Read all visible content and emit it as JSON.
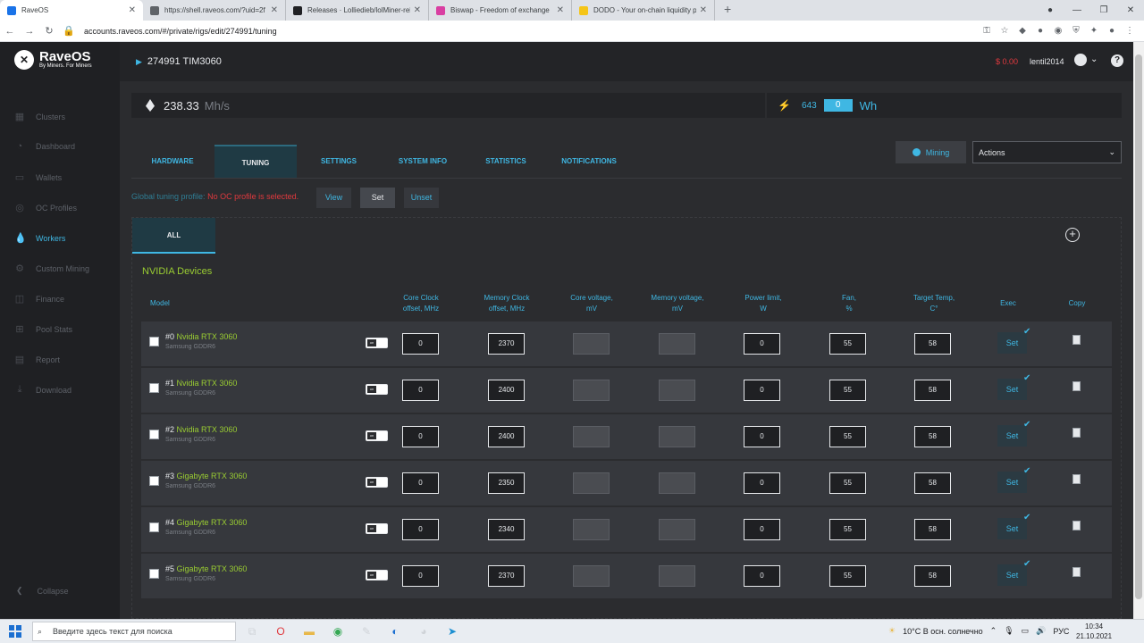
{
  "browser": {
    "tabs": [
      {
        "title": "RaveOS",
        "color": "#1a73e8",
        "active": true
      },
      {
        "title": "https://shell.raveos.com/?uid=2f",
        "color": "#5f6368",
        "active": false
      },
      {
        "title": "Releases · Lolliedieb/lolMiner-rel",
        "color": "#202124",
        "active": false
      },
      {
        "title": "Biswap - Freedom of exchange",
        "color": "#d93fa2",
        "active": false
      },
      {
        "title": "DODO - Your on-chain liquidity p",
        "color": "#f5c518",
        "active": false
      }
    ],
    "url": "accounts.raveos.com/#/private/rigs/edit/274991/tuning"
  },
  "app": {
    "logo_name": "RaveOS",
    "logo_sub": "By Miners. For Miners",
    "rig_title": "274991 TIM3060",
    "balance": "$ 0.00",
    "username": "lentil2014"
  },
  "sidebar": {
    "items": [
      {
        "label": "Clusters",
        "icon": "▦"
      },
      {
        "label": "Dashboard",
        "icon": "◔"
      },
      {
        "label": "Wallets",
        "icon": "▭"
      },
      {
        "label": "OC Profiles",
        "icon": "◎"
      },
      {
        "label": "Workers",
        "icon": "💧"
      },
      {
        "label": "Custom Mining",
        "icon": "⚙"
      },
      {
        "label": "Finance",
        "icon": "◫"
      },
      {
        "label": "Pool Stats",
        "icon": "⊞"
      },
      {
        "label": "Report",
        "icon": "▤"
      },
      {
        "label": "Download",
        "icon": "⤓"
      }
    ],
    "collapse": "Collapse"
  },
  "stats": {
    "hashrate": "238.33",
    "hash_unit": "Mh/s",
    "power_a": "643",
    "power_b": "0",
    "power_unit": "Wh"
  },
  "tabs": [
    "HARDWARE",
    "TUNING",
    "SETTINGS",
    "SYSTEM INFO",
    "STATISTICS",
    "NOTIFICATIONS"
  ],
  "mining_label": "Mining",
  "actions_label": "Actions",
  "global": {
    "label": "Global tuning profile:",
    "status": "No OC profile is selected.",
    "view": "View",
    "set": "Set",
    "unset": "Unset"
  },
  "panel": {
    "all_tab": "ALL",
    "section": "NVIDIA Devices"
  },
  "headers": {
    "model": "Model",
    "core_clock_1": "Core Clock",
    "core_clock_2": "offset, MHz",
    "mem_clock_1": "Memory Clock",
    "mem_clock_2": "offset, MHz",
    "core_v_1": "Core voltage,",
    "core_v_2": "mV",
    "mem_v_1": "Memory voltage,",
    "mem_v_2": "mV",
    "power_1": "Power limit,",
    "power_2": "W",
    "fan_1": "Fan,",
    "fan_2": "%",
    "temp_1": "Target Temp,",
    "temp_2": "C°",
    "exec": "Exec",
    "copy": "Copy"
  },
  "gpus": [
    {
      "idx": "#0",
      "name": "Nvidia RTX 3060",
      "mem": "Samsung GDDR6",
      "core": "0",
      "memclk": "2370",
      "power": "0",
      "fan": "55",
      "temp": "58"
    },
    {
      "idx": "#1",
      "name": "Nvidia RTX 3060",
      "mem": "Samsung GDDR6",
      "core": "0",
      "memclk": "2400",
      "power": "0",
      "fan": "55",
      "temp": "58"
    },
    {
      "idx": "#2",
      "name": "Nvidia RTX 3060",
      "mem": "Samsung GDDR6",
      "core": "0",
      "memclk": "2400",
      "power": "0",
      "fan": "55",
      "temp": "58"
    },
    {
      "idx": "#3",
      "name": "Gigabyte RTX 3060",
      "mem": "Samsung GDDR6",
      "core": "0",
      "memclk": "2350",
      "power": "0",
      "fan": "55",
      "temp": "58"
    },
    {
      "idx": "#4",
      "name": "Gigabyte RTX 3060",
      "mem": "Samsung GDDR6",
      "core": "0",
      "memclk": "2340",
      "power": "0",
      "fan": "55",
      "temp": "58"
    },
    {
      "idx": "#5",
      "name": "Gigabyte RTX 3060",
      "mem": "Samsung GDDR6",
      "core": "0",
      "memclk": "2370",
      "power": "0",
      "fan": "55",
      "temp": "58"
    }
  ],
  "toggle_label": "on",
  "exec_label": "Set",
  "taskbar": {
    "search": "Введите здесь текст для поиска",
    "weather": "10°C  В осн. солнечно",
    "lang": "РУС",
    "time": "10:34",
    "date": "21.10.2021"
  }
}
